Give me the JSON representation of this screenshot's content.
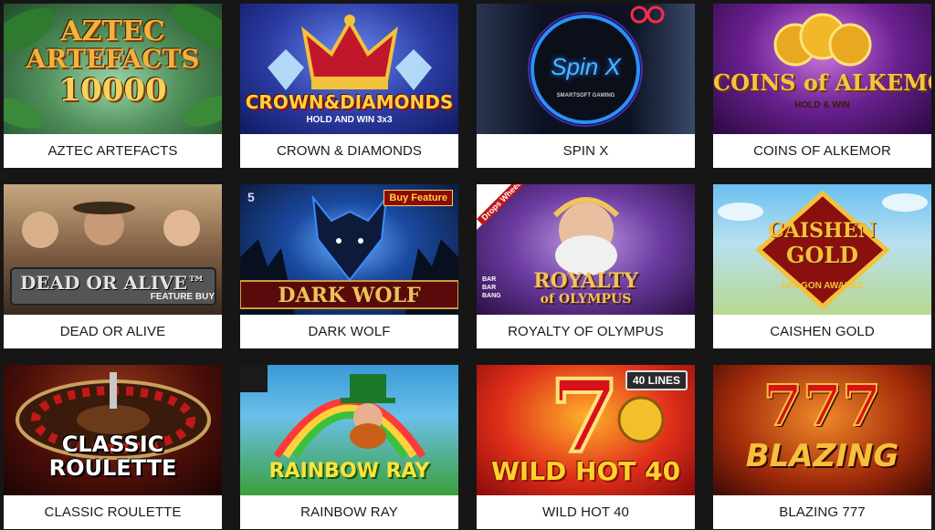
{
  "games": [
    {
      "id": "aztec-artefacts",
      "label": "AZTEC ARTEFACTS",
      "logo_lines": [
        "AZTEC",
        "ARTEFACTS",
        "10000"
      ],
      "bg": [
        "#2f6b3a",
        "#8fc9a0"
      ],
      "logo_color": "#f2b13a"
    },
    {
      "id": "crown-diamonds",
      "label": "CROWN & DIAMONDS",
      "logo_lines": [
        "CROWN&DIAMONDS"
      ],
      "tagline": "HOLD AND WIN 3x3",
      "bg": [
        "#1d2a7a",
        "#4b6bd6"
      ],
      "logo_color": "#ffd23a"
    },
    {
      "id": "spin-x",
      "label": "SPIN X",
      "logo_lines": [
        "Spin X"
      ],
      "provider": "SMARTSOFT GAMING",
      "bg": [
        "#0a1020",
        "#3a4a7a"
      ],
      "logo_color": "#3aa8ff"
    },
    {
      "id": "coins-of-alkemor",
      "label": "COINS OF ALKEMOR",
      "logo_lines": [
        "COINS of ALKEMOR"
      ],
      "tagline": "HOLD & WIN",
      "bg": [
        "#3a1050",
        "#7a2aa0"
      ],
      "logo_color": "#f6c53a"
    },
    {
      "id": "dead-or-alive",
      "label": "DEAD OR ALIVE",
      "logo_lines": [
        "DEAD OR ALIVE™"
      ],
      "tagline": "FEATURE BUY",
      "bg": [
        "#5a4030",
        "#a98a6a"
      ],
      "logo_color": "#d7d7d7"
    },
    {
      "id": "dark-wolf",
      "label": "DARK WOLF",
      "logo_lines": [
        "DARK WOLF"
      ],
      "badge": "Buy Feature",
      "badge_number": "5",
      "bg": [
        "#0a1a40",
        "#2a6ad0"
      ],
      "logo_color": "#f2c05a"
    },
    {
      "id": "royalty-of-olympus",
      "label": "ROYALTY OF OLYMPUS",
      "logo_lines": [
        "ROYALTY",
        "of OLYMPUS"
      ],
      "badge": "Drops Wheels",
      "corner_text": [
        "BAR",
        "BAR",
        "BANG"
      ],
      "bg": [
        "#3a2060",
        "#8a5ac0"
      ],
      "logo_color": "#f2c35a"
    },
    {
      "id": "caishen-gold",
      "label": "CAISHEN GOLD",
      "logo_lines": [
        "CAISHEN",
        "GOLD"
      ],
      "tagline": "DRAGON AWAKES",
      "bg": [
        "#4aa0d0",
        "#c9e3a0"
      ],
      "logo_color": "#f3c23a"
    },
    {
      "id": "classic-roulette",
      "label": "CLASSIC ROULETTE",
      "logo_lines": [
        "CLASSIC",
        "ROULETTE"
      ],
      "bg": [
        "#3a0a0a",
        "#9a2a1a"
      ],
      "logo_color": "#ffffff"
    },
    {
      "id": "rainbow-ray",
      "label": "RAINBOW RAY",
      "logo_lines": [
        "RAINBOW RAY"
      ],
      "bg": [
        "#2a7ab0",
        "#46b046"
      ],
      "logo_color": "#ffe23a"
    },
    {
      "id": "wild-hot-40",
      "label": "WILD HOT 40",
      "logo_lines": [
        "WILD HOT 40"
      ],
      "badge": "40 LINES",
      "bg": [
        "#c01010",
        "#f0a020"
      ],
      "logo_color": "#ffd22a"
    },
    {
      "id": "blazing-777",
      "label": "BLAZING 777",
      "logo_lines": [
        "777",
        "BLAZING"
      ],
      "bg": [
        "#8a1a0a",
        "#e06a1a"
      ],
      "logo_color": "#f6c03a"
    }
  ]
}
